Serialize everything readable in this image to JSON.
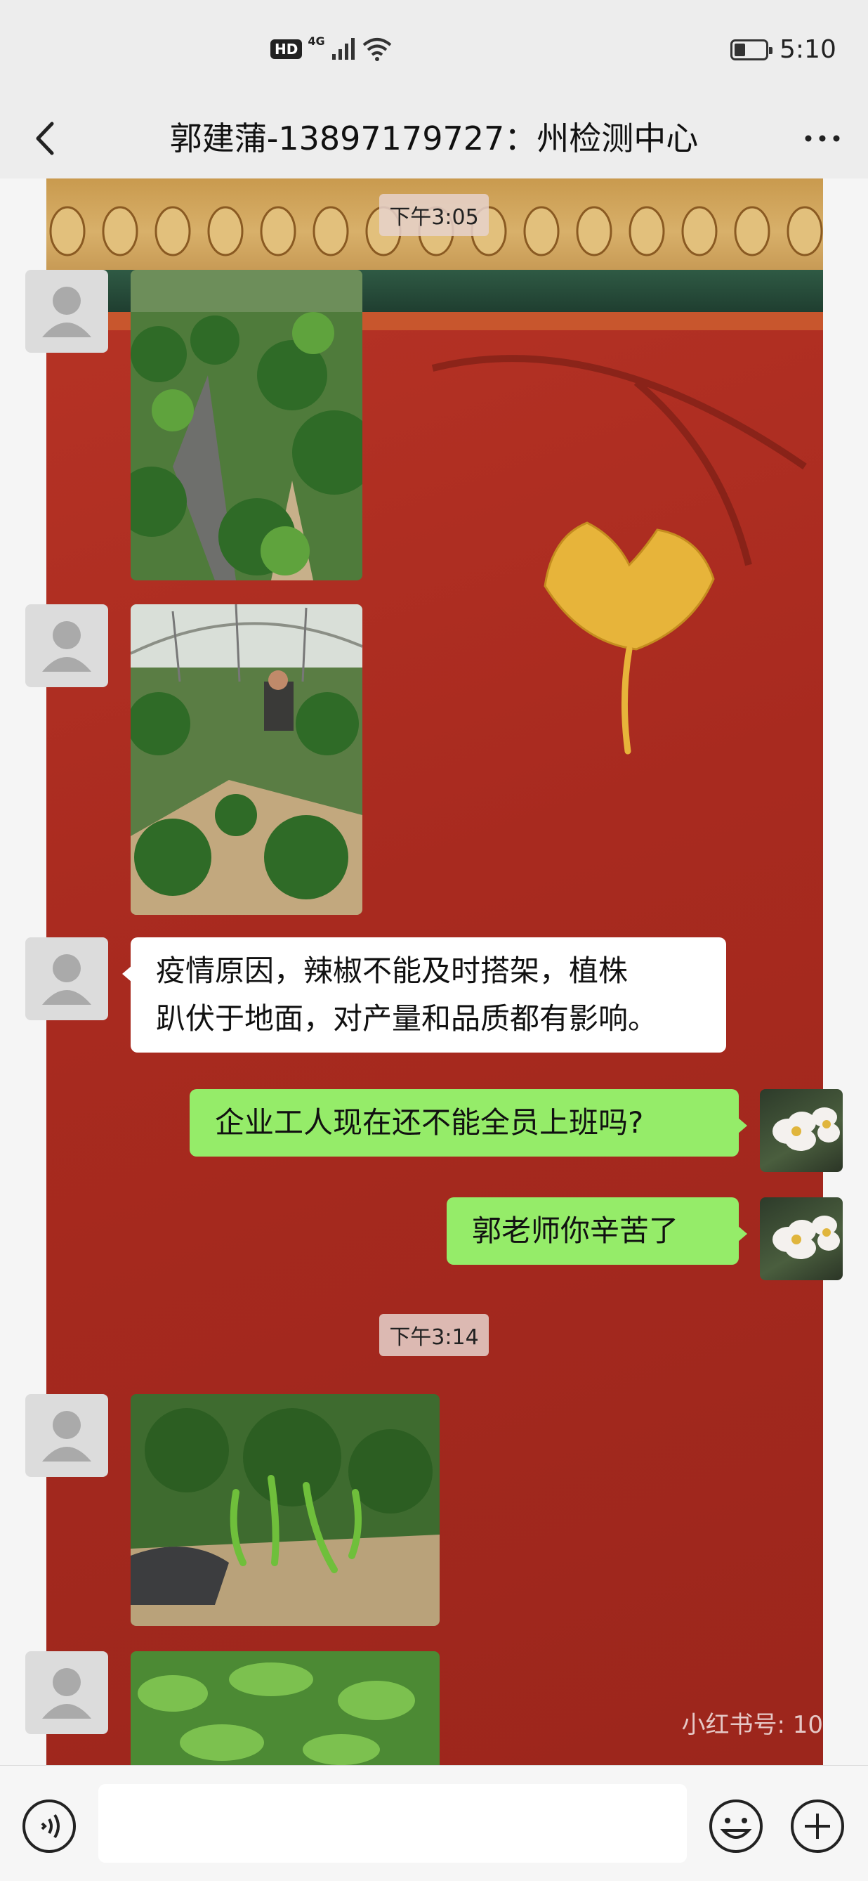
{
  "status_bar": {
    "hd": "HD",
    "network": "4G",
    "time": "5:10",
    "battery_level": 0.35
  },
  "header": {
    "title": "郭建蒲-13897179727：州检测中心"
  },
  "chat": {
    "timestamps": [
      "下午3:05",
      "下午3:14"
    ],
    "messages": [
      {
        "type": "image",
        "side": "in",
        "depicts": "pepper plants in greenhouse"
      },
      {
        "type": "image",
        "side": "in",
        "depicts": "worker tending pepper plants"
      },
      {
        "type": "text",
        "side": "in",
        "lines": [
          "疫情原因，辣椒不能及时搭架，植株",
          "趴伏于地面，对产量和品质都有影响。"
        ]
      },
      {
        "type": "text",
        "side": "out",
        "text": "企业工人现在还不能全员上班吗?"
      },
      {
        "type": "text",
        "side": "out",
        "text": "郭老师你辛苦了"
      },
      {
        "type": "image",
        "side": "in",
        "depicts": "drooping pepper plants"
      },
      {
        "type": "image",
        "side": "in",
        "depicts": "pepper leaves"
      }
    ],
    "watermark": "小红书号: 10"
  },
  "colors": {
    "outgoing_bubble": "#95ec69",
    "incoming_bubble": "#ffffff",
    "wallpaper_red": "#a82a1f"
  },
  "icons": [
    "back-icon",
    "more-icon",
    "voice-icon",
    "emoji-icon",
    "plus-icon",
    "default-avatar-icon"
  ]
}
